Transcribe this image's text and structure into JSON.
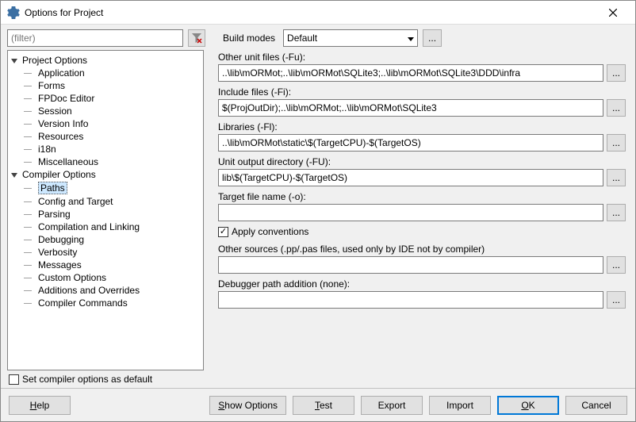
{
  "title": "Options for Project",
  "filter": {
    "placeholder": "(filter)"
  },
  "buildmodes": {
    "label": "Build modes",
    "value": "Default"
  },
  "tree": {
    "group1": {
      "label": "Project Options",
      "items": [
        {
          "label": "Application"
        },
        {
          "label": "Forms"
        },
        {
          "label": "FPDoc Editor"
        },
        {
          "label": "Session"
        },
        {
          "label": "Version Info"
        },
        {
          "label": "Resources"
        },
        {
          "label": "i18n"
        },
        {
          "label": "Miscellaneous"
        }
      ]
    },
    "group2": {
      "label": "Compiler Options",
      "items": [
        {
          "label": "Paths",
          "selected": true
        },
        {
          "label": "Config and Target"
        },
        {
          "label": "Parsing"
        },
        {
          "label": "Compilation and Linking"
        },
        {
          "label": "Debugging"
        },
        {
          "label": "Verbosity"
        },
        {
          "label": "Messages"
        },
        {
          "label": "Custom Options"
        },
        {
          "label": "Additions and Overrides"
        },
        {
          "label": "Compiler Commands"
        }
      ]
    }
  },
  "form": {
    "otherunit": {
      "label": "Other unit files (-Fu):",
      "value": "..\\lib\\mORMot;..\\lib\\mORMot\\SQLite3;..\\lib\\mORMot\\SQLite3\\DDD\\infra"
    },
    "include": {
      "label": "Include files (-Fi):",
      "value": "$(ProjOutDir);..\\lib\\mORMot;..\\lib\\mORMot\\SQLite3"
    },
    "libraries": {
      "label": "Libraries (-Fl):",
      "value": "..\\lib\\mORMot\\static\\$(TargetCPU)-$(TargetOS)"
    },
    "unitoutput": {
      "label": "Unit output directory (-FU):",
      "value": "lib\\$(TargetCPU)-$(TargetOS)"
    },
    "target": {
      "label": "Target file name (-o):",
      "value": ""
    },
    "applyconv": {
      "label": "Apply conventions",
      "checked": true
    },
    "othersrc": {
      "label": "Other sources (.pp/.pas files, used only by IDE not by compiler)",
      "value": ""
    },
    "dbgpath": {
      "label": "Debugger path addition (none):",
      "value": ""
    }
  },
  "setdefault": {
    "label": "Set compiler options as default",
    "checked": false
  },
  "footer": {
    "help": "Help",
    "showoptions": "Show Options",
    "test": "Test",
    "export": "Export",
    "import": "Import",
    "ok": "OK",
    "cancel": "Cancel"
  },
  "ellipsis": "..."
}
